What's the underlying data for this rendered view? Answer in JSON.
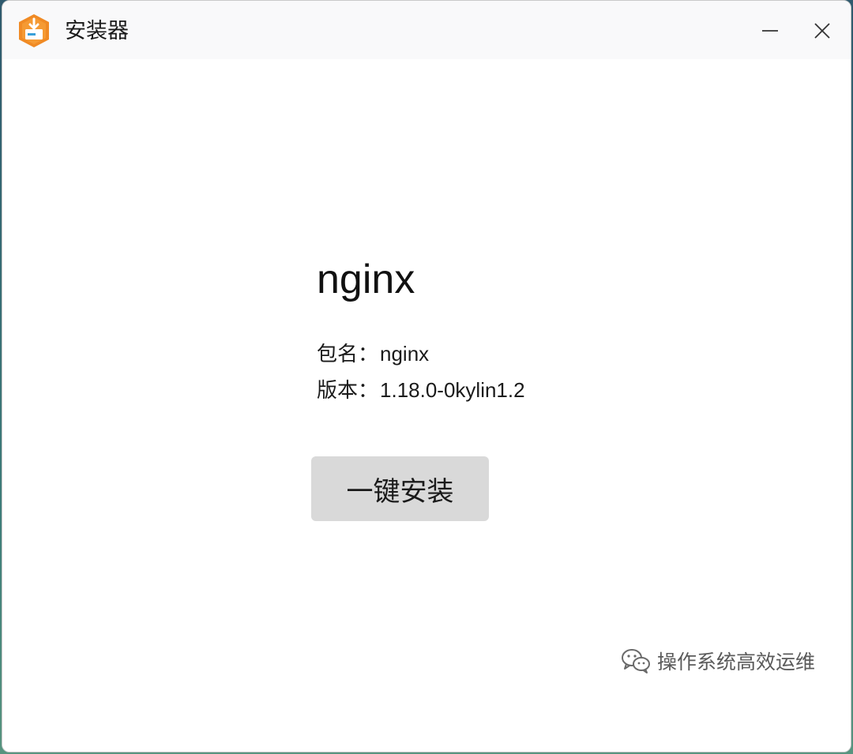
{
  "window": {
    "title": "安装器",
    "app_icon": "installer-icon",
    "controls": {
      "minimize_icon": "minimize-icon",
      "close_icon": "close-icon"
    }
  },
  "package": {
    "title": "nginx",
    "name_label": "包名：",
    "name_value": "nginx",
    "version_label": "版本：",
    "version_value": "1.18.0-0kylin1.2"
  },
  "actions": {
    "install_label": "一键安装"
  },
  "watermark": {
    "text": "操作系统高效运维",
    "icon": "wechat-icon"
  },
  "colors": {
    "accent": "#f08a24",
    "button_bg": "#d9d9d9",
    "titlebar_bg": "#f9f9fa"
  }
}
